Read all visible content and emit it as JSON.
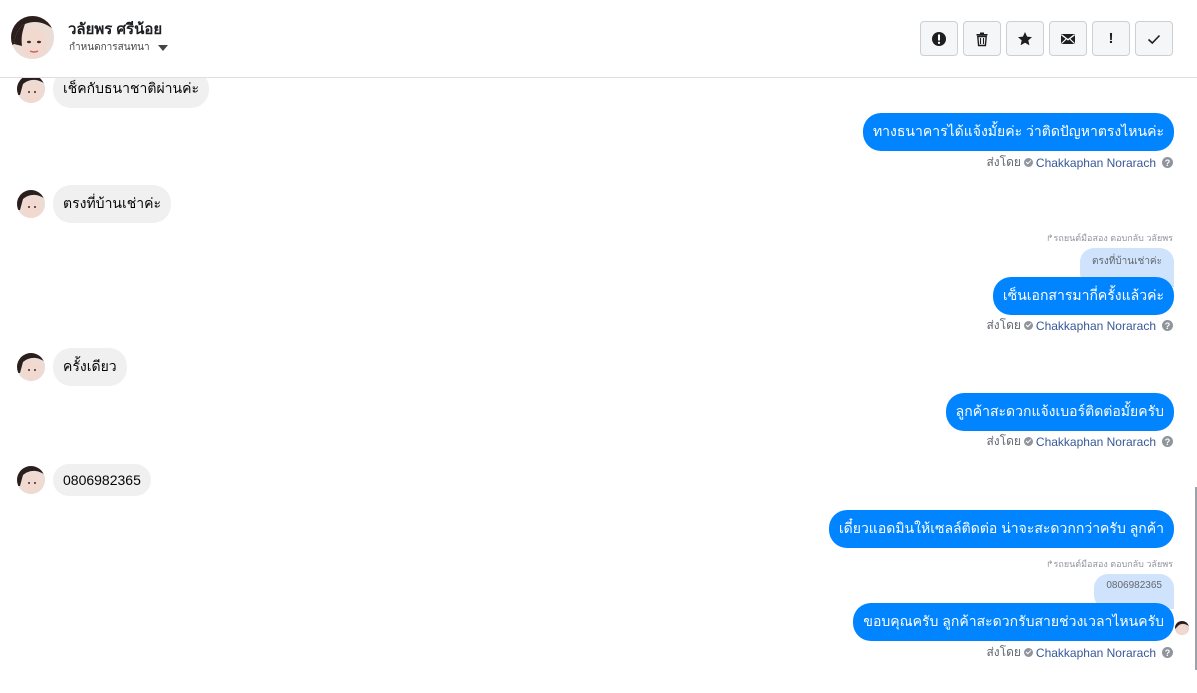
{
  "header": {
    "contact_name": "วลัยพร ศรีน้อย",
    "label_select": "กำหนดการสนทนา",
    "actions": [
      {
        "icon": "alert-circle-icon",
        "glyph": ""
      },
      {
        "icon": "trash-icon",
        "glyph": ""
      },
      {
        "icon": "star-icon",
        "glyph": ""
      },
      {
        "icon": "envelope-icon",
        "glyph": ""
      },
      {
        "icon": "exclamation-icon",
        "glyph": "!"
      },
      {
        "icon": "checkmark-icon",
        "glyph": ""
      }
    ]
  },
  "thread": {
    "sent_prefix": "ส่งโดย",
    "agent_name": "Chakkaphan Norarach",
    "help_glyph": "?",
    "messages": [
      {
        "dir": "in",
        "text": "เช็คกับธนาชาติผ่านค่ะ"
      },
      {
        "dir": "out",
        "text": "ทางธนาคารได้แจ้งมั้ยค่ะ ว่าติดปัญหาตรงไหนค่ะ"
      },
      {
        "dir": "in",
        "text": "ตรงที่บ้านเช่าค่ะ"
      },
      {
        "dir": "out",
        "reply_note": "↱รถยนต์มือสอง ตอบกลับ วลัยพร",
        "quote": "ตรงที่บ้านเช่าค่ะ",
        "text": "เซ็นเอกสารมากี่ครั้งแล้วค่ะ"
      },
      {
        "dir": "in",
        "text": "ครั้งเดียว"
      },
      {
        "dir": "out",
        "text": "ลูกค้าสะดวกแจ้งเบอร์ติดต่อมั้ยครับ"
      },
      {
        "dir": "in",
        "text": "0806982365"
      },
      {
        "dir": "out",
        "text": "เดี๋ยวแอดมินให้เซลล์ติดต่อ น่าจะสะดวกกว่าครับ ลูกค้า"
      },
      {
        "dir": "out",
        "reply_note": "↱รถยนต์มือสอง ตอบกลับ วลัยพร",
        "quote": "0806982365",
        "text": "ขอบคุณครับ ลูกค้าสะดวกรับสายช่วงเวลาไหนครับ"
      }
    ]
  },
  "colors": {
    "outgoing_bubble": "#0084ff",
    "incoming_bubble": "#f0f0f0",
    "quote_bubble": "#cfe3fd",
    "agent_link": "#385898"
  }
}
